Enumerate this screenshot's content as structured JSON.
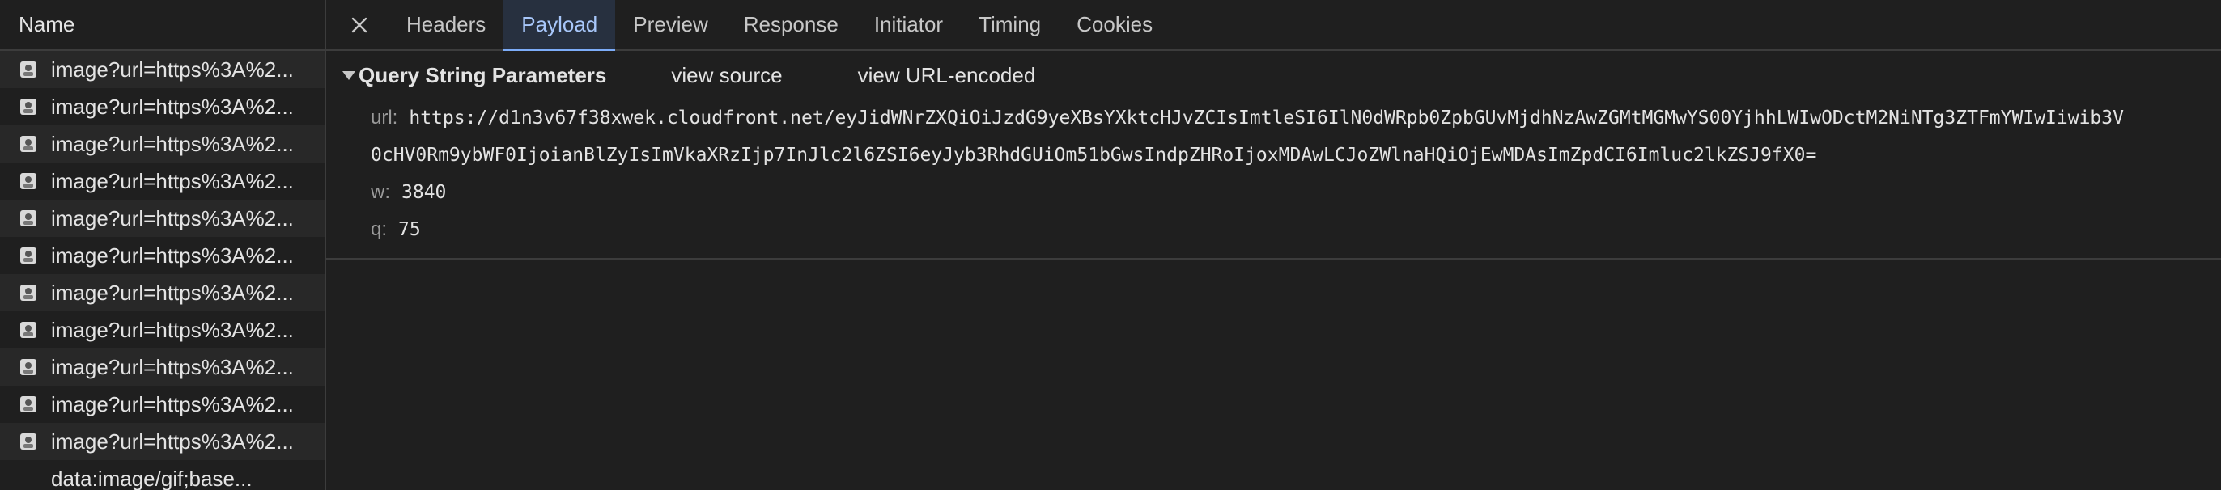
{
  "left_panel": {
    "header": "Name",
    "requests": [
      {
        "label": "image?url=https%3A%2...",
        "icon": "image-thumbnail-icon"
      },
      {
        "label": "image?url=https%3A%2...",
        "icon": "image-thumbnail-icon"
      },
      {
        "label": "image?url=https%3A%2...",
        "icon": "image-thumbnail-icon"
      },
      {
        "label": "image?url=https%3A%2...",
        "icon": "image-thumbnail-icon"
      },
      {
        "label": "image?url=https%3A%2...",
        "icon": "image-thumbnail-icon"
      },
      {
        "label": "image?url=https%3A%2...",
        "icon": "image-thumbnail-icon"
      },
      {
        "label": "image?url=https%3A%2...",
        "icon": "image-thumbnail-icon"
      },
      {
        "label": "image?url=https%3A%2...",
        "icon": "image-thumbnail-icon"
      },
      {
        "label": "image?url=https%3A%2...",
        "icon": "image-thumbnail-icon"
      },
      {
        "label": "image?url=https%3A%2...",
        "icon": "image-thumbnail-icon"
      },
      {
        "label": "image?url=https%3A%2...",
        "icon": "image-thumbnail-icon"
      },
      {
        "label": "data:image/gif;base...",
        "icon": "none"
      }
    ]
  },
  "tabs": [
    {
      "label": "Headers",
      "active": false
    },
    {
      "label": "Payload",
      "active": true
    },
    {
      "label": "Preview",
      "active": false
    },
    {
      "label": "Response",
      "active": false
    },
    {
      "label": "Initiator",
      "active": false
    },
    {
      "label": "Timing",
      "active": false
    },
    {
      "label": "Cookies",
      "active": false
    }
  ],
  "payload": {
    "section_title": "Query String Parameters",
    "view_source": "view source",
    "view_url_encoded": "view URL-encoded",
    "params": {
      "url_key": "url:",
      "url_value_line1": "https://d1n3v67f38xwek.cloudfront.net/eyJidWNrZXQiOiJzdG9yeXBsYXktcHJvZCIsImtleSI6IlN0dWRpb0ZpbGUvMjdhNzAwZGMtMGMwYS00YjhhLWIwODctM2NiNTg3ZTFmYWIwIiwib3V",
      "url_value_line2": "0cHV0Rm9ybWF0IjoianBlZyIsImVkaXRzIjp7InJlc2l6ZSI6eyJyb3RhdGUiOm51bGwsIndpZHRoIjoxMDAwLCJoZWlnaHQiOjEwMDAsImZpdCI6Imluc2lkZSJ9fX0=",
      "w_key": "w:",
      "w_value": "3840",
      "q_key": "q:",
      "q_value": "75"
    }
  },
  "colors": {
    "background": "#1f1f1f",
    "active_tab_text": "#a8c7fa",
    "active_tab_underline": "#7cacf8",
    "divider": "#3c3c3c"
  }
}
